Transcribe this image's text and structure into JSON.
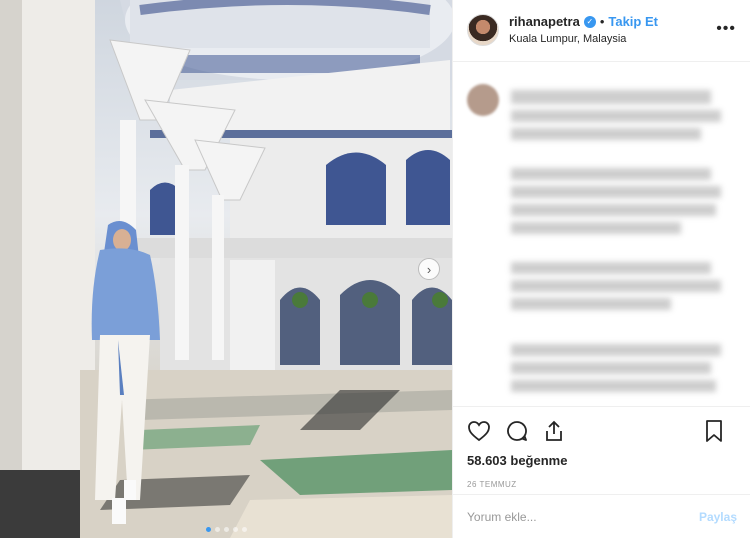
{
  "post": {
    "image_alt": "",
    "carousel": {
      "slide_count": 5,
      "active_index": 0
    }
  },
  "header": {
    "username": "rihanapetra",
    "separator": "•",
    "follow_label": "Takip Et",
    "location": "Kuala Lumpur, Malaysia",
    "more_icon": "more-horizontal-icon"
  },
  "actions": {
    "like_icon": "heart-icon",
    "comment_icon": "comment-icon",
    "share_icon": "share-icon",
    "save_icon": "bookmark-icon"
  },
  "likes": {
    "text": "58.603 beğenme"
  },
  "date": "26 TEMMUZ",
  "comment_box": {
    "placeholder": "Yorum ekle...",
    "post_label": "Paylaş"
  },
  "colors": {
    "accent": "#3897f0",
    "post_disabled": "#b3dbff",
    "text": "#262626",
    "muted": "#999999",
    "border": "#efefef"
  }
}
